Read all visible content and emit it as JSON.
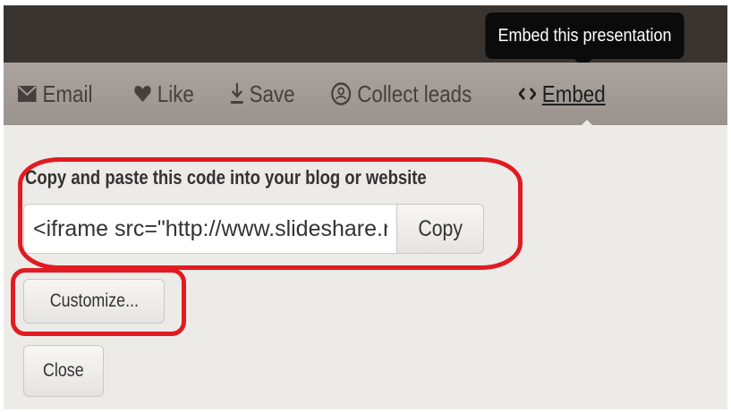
{
  "header": {
    "tooltip": "Embed this presentation"
  },
  "toolbar": {
    "email_label": "Email",
    "like_label": "Like",
    "save_label": "Save",
    "collect_leads_label": "Collect leads",
    "embed_label": "Embed",
    "active_item": "Embed"
  },
  "embed_panel": {
    "instruction": "Copy and paste this code into your blog or website",
    "code_value": "<iframe src=\"http://www.slideshare.r",
    "copy_label": "Copy",
    "customize_label": "Customize...",
    "close_label": "Close"
  },
  "colors": {
    "top_bar": "#3a3431",
    "toolbar": "#a39c96",
    "panel": "#ecebe7",
    "highlight": "#e11b22"
  },
  "icons": {
    "email": "envelope-icon",
    "like": "heart-icon",
    "save": "download-icon",
    "collect_leads": "leads-icon",
    "embed": "code-icon"
  }
}
